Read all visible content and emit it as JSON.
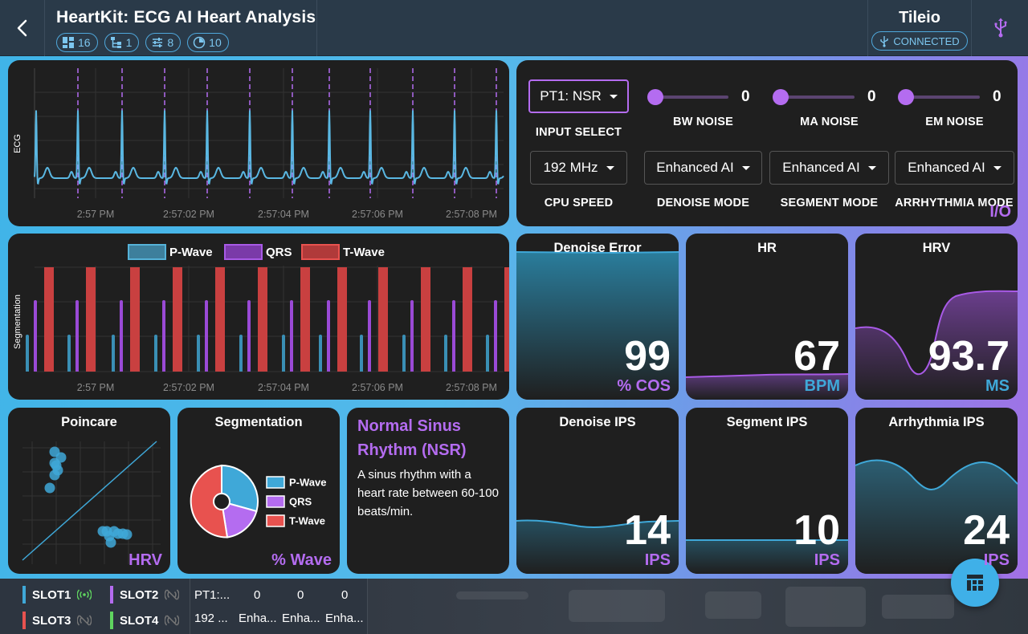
{
  "header": {
    "title": "HeartKit: ECG AI Heart Analysis",
    "chips": [
      {
        "icon": "dashboard-icon",
        "count": "16"
      },
      {
        "icon": "flow-icon",
        "count": "1"
      },
      {
        "icon": "sliders-icon",
        "count": "8"
      },
      {
        "icon": "dial-icon",
        "count": "10"
      }
    ],
    "device_name": "Tileio",
    "connection_status": "CONNECTED"
  },
  "ecg": {
    "ylabel": "ECG",
    "ticks": [
      "2:57 PM",
      "2:57:02 PM",
      "2:57:04 PM",
      "2:57:06 PM",
      "2:57:08 PM"
    ]
  },
  "controls": {
    "input_select": {
      "value": "PT1: NSR",
      "label": "INPUT SELECT"
    },
    "cpu_speed": {
      "value": "192 MHz",
      "label": "CPU SPEED"
    },
    "bw_noise": {
      "value": "0",
      "label": "BW NOISE"
    },
    "ma_noise": {
      "value": "0",
      "label": "MA NOISE"
    },
    "em_noise": {
      "value": "0",
      "label": "EM NOISE"
    },
    "denoise_mode": {
      "value": "Enhanced AI",
      "label": "DENOISE MODE"
    },
    "segment_mode": {
      "value": "Enhanced AI",
      "label": "SEGMENT MODE"
    },
    "arrhythmia_mode": {
      "value": "Enhanced AI",
      "label": "ARRHYTHMIA MODE"
    },
    "io_label": "I/O"
  },
  "segmentation_chart": {
    "ylabel": "Segmentation",
    "legend": [
      "P-Wave",
      "QRS",
      "T-Wave"
    ],
    "ticks": [
      "2:57 PM",
      "2:57:02 PM",
      "2:57:04 PM",
      "2:57:06 PM",
      "2:57:08 PM"
    ]
  },
  "metrics": {
    "denoise_error": {
      "title": "Denoise Error",
      "value": "99",
      "unit": "% COS"
    },
    "hr": {
      "title": "HR",
      "value": "67",
      "unit": "BPM"
    },
    "hrv": {
      "title": "HRV",
      "value": "93.7",
      "unit": "MS"
    },
    "denoise_ips": {
      "title": "Denoise IPS",
      "value": "14",
      "unit": "IPS"
    },
    "segment_ips": {
      "title": "Segment IPS",
      "value": "10",
      "unit": "IPS"
    },
    "arrhythmia_ips": {
      "title": "Arrhythmia IPS",
      "value": "24",
      "unit": "IPS"
    }
  },
  "poincare": {
    "title": "Poincare",
    "corner": "HRV"
  },
  "segmentation_pie": {
    "title": "Segmentation",
    "corner": "% Wave",
    "legend": [
      "P-Wave",
      "QRS",
      "T-Wave"
    ]
  },
  "rhythm": {
    "title": "Normal Sinus Rhythm (NSR)",
    "description": "A sinus rhythm with a heart rate between 60-100 beats/min."
  },
  "footer": {
    "slots": [
      {
        "label": "SLOT1",
        "color": "#3fa8d8",
        "status": "connected"
      },
      {
        "label": "SLOT2",
        "color": "#b46cf0",
        "status": "disconnected"
      },
      {
        "label": "SLOT3",
        "color": "#e8524f",
        "status": "disconnected"
      },
      {
        "label": "SLOT4",
        "color": "#5fd45f",
        "status": "disconnected"
      }
    ],
    "row1": [
      "PT1:...",
      "0",
      "0",
      "0"
    ],
    "row2": [
      "192 ...",
      "Enha...",
      "Enha...",
      "Enha..."
    ]
  },
  "colors": {
    "accent_purple": "#b46cf0",
    "accent_blue": "#3fa8d8",
    "t_wave_red": "#e8524f"
  }
}
